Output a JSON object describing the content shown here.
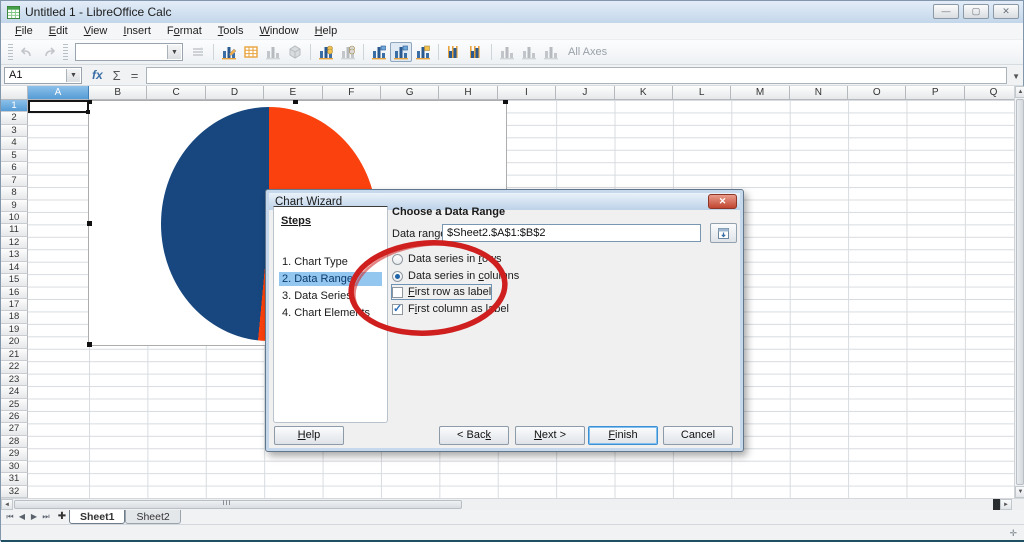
{
  "window": {
    "title": "Untitled 1 - LibreOffice Calc"
  },
  "window_controls": {
    "minimize": "—",
    "maximize": "▢",
    "close": "✕"
  },
  "menu": {
    "items": [
      {
        "label": "File",
        "u": 0
      },
      {
        "label": "Edit",
        "u": 0
      },
      {
        "label": "View",
        "u": 0
      },
      {
        "label": "Insert",
        "u": 0
      },
      {
        "label": "Format",
        "u": 1
      },
      {
        "label": "Tools",
        "u": 0
      },
      {
        "label": "Window",
        "u": 0
      },
      {
        "label": "Help",
        "u": 0
      }
    ]
  },
  "toolbar": {
    "all_axes_label": "All Axes",
    "icons": [
      {
        "name": "undo-icon",
        "kind": "undo",
        "enabled": false
      },
      {
        "name": "redo-icon",
        "kind": "redo",
        "enabled": false
      },
      {
        "name": "format-selection-icon",
        "kind": "format",
        "enabled": false
      },
      {
        "name": "chart-type-icon",
        "kind": "bars-pencil",
        "enabled": true
      },
      {
        "name": "data-table-icon",
        "kind": "grid",
        "enabled": true
      },
      {
        "name": "titles-icon",
        "kind": "bars",
        "enabled": false
      },
      {
        "name": "chart-wall-icon",
        "kind": "cube",
        "enabled": false
      },
      {
        "name": "data-in-rows-icon",
        "kind": "bars-coins",
        "enabled": true
      },
      {
        "name": "data-in-columns-icon",
        "kind": "bars-coins",
        "enabled": false
      },
      {
        "name": "legend-on-off-icon",
        "kind": "bars-blue",
        "enabled": true
      },
      {
        "name": "automatic-layout-icon",
        "kind": "bars-blue",
        "enabled": true,
        "pressed": true
      },
      {
        "name": "scale-text-icon",
        "kind": "bars-badge",
        "enabled": true
      },
      {
        "name": "x-axis-grid-icon",
        "kind": "bars-stripes",
        "enabled": true
      },
      {
        "name": "y-axis-grid-icon",
        "kind": "bars-stripes",
        "enabled": true
      },
      {
        "name": "x-axis-icon",
        "kind": "bars",
        "enabled": false
      },
      {
        "name": "y-axis-icon",
        "kind": "bars",
        "enabled": false
      },
      {
        "name": "z-axis-icon",
        "kind": "bars",
        "enabled": false
      }
    ]
  },
  "formula_bar": {
    "cell_reference": "A1",
    "fx_icon": "fx",
    "sum_icon": "Σ",
    "equals_icon": "=",
    "formula_value": ""
  },
  "sheet": {
    "selected_column": "A",
    "columns": [
      "B",
      "C",
      "D",
      "E",
      "F",
      "G",
      "H",
      "I",
      "J",
      "K",
      "L",
      "M",
      "N",
      "O",
      "P",
      "Q"
    ],
    "row_count": 32,
    "selected_row": 1
  },
  "chart_wizard": {
    "title": "Chart Wizard",
    "steps_heading": "Steps",
    "steps": [
      "1. Chart Type",
      "2. Data Range",
      "3. Data Series",
      "4. Chart Elements"
    ],
    "active_step_index": 1,
    "panel_heading": "Choose a Data Range",
    "data_range_label": "Data range:",
    "data_range_value": "$Sheet2.$A$1:$B$2",
    "options": [
      {
        "type": "radio",
        "label": "Data series in rows",
        "u": 15,
        "checked": false,
        "focused": false
      },
      {
        "type": "radio",
        "label": "Data series in columns",
        "u": 15,
        "checked": true,
        "focused": false
      },
      {
        "type": "checkbox",
        "label": "First row as label",
        "u": 0,
        "checked": false,
        "focused": true
      },
      {
        "type": "checkbox",
        "label": "First column as label",
        "u": 1,
        "checked": true,
        "focused": false
      }
    ],
    "buttons": [
      {
        "label": "Help",
        "u": 0,
        "default": false
      },
      {
        "label": "< Back",
        "u": 5,
        "default": false
      },
      {
        "label": "Next >",
        "u": 0,
        "default": false
      },
      {
        "label": "Finish",
        "u": 0,
        "default": true
      },
      {
        "label": "Cancel",
        "u": -1,
        "default": false
      }
    ]
  },
  "sheet_tabs": {
    "tabs": [
      "Sheet1",
      "Sheet2"
    ],
    "active": "Sheet1"
  },
  "colors": {
    "pie_blue": "#17477e",
    "pie_orange": "#fb420e",
    "annotation_red": "#cf1f1f",
    "header_selection_blue": "#569cd5",
    "step_highlight": "#94c7f0"
  },
  "chart_data": {
    "type": "pie",
    "title": "",
    "legend": false,
    "slices": [
      {
        "color": "#fb420e",
        "estimated_pct": 51.5,
        "start_angle_deg_from_top": 0
      },
      {
        "color": "#17477e",
        "estimated_pct": 48.5,
        "start_angle_deg_from_top": 185.4
      }
    ],
    "source_range": "$Sheet2.$A$1:$B$2"
  }
}
